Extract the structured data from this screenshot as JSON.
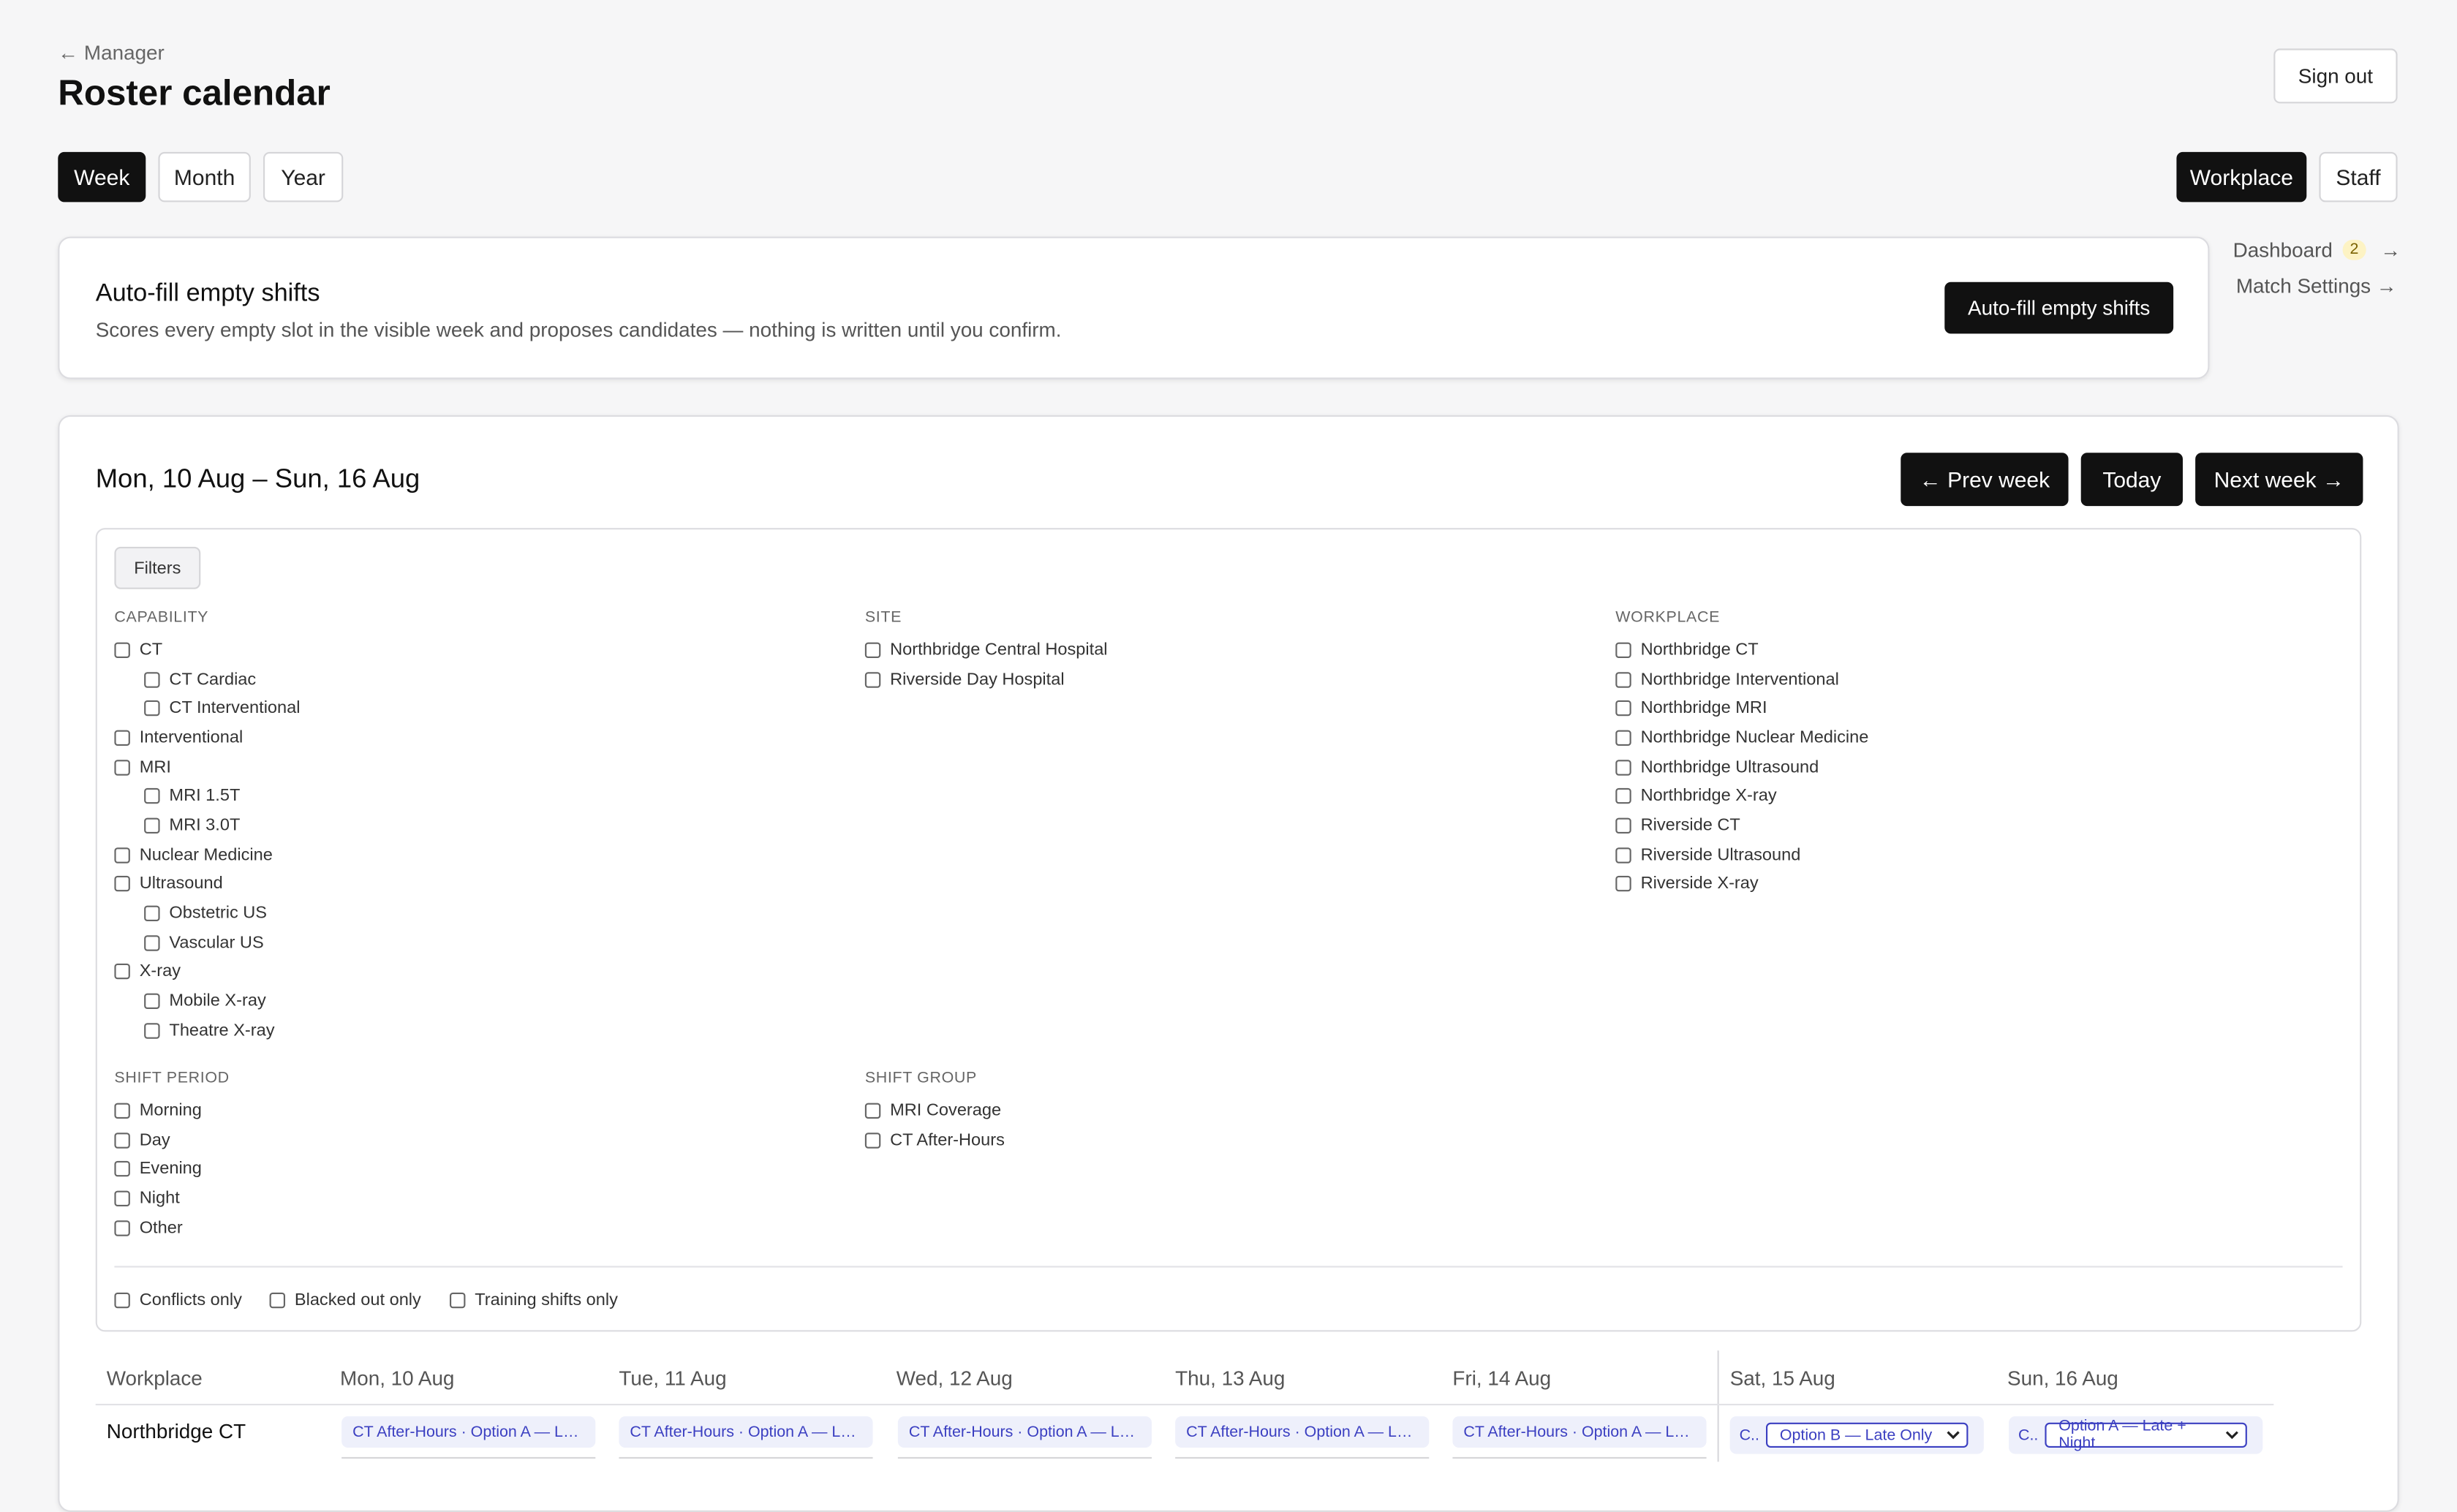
{
  "header": {
    "back_link": "← Manager",
    "title": "Roster calendar",
    "sign_out": "Sign out"
  },
  "view_tabs": [
    {
      "label": "Week",
      "active": true
    },
    {
      "label": "Month",
      "active": false
    },
    {
      "label": "Year",
      "active": false
    }
  ],
  "mode_tabs": [
    {
      "label": "Workplace",
      "active": true
    },
    {
      "label": "Staff",
      "active": false
    }
  ],
  "side_links": {
    "dashboard": "Dashboard",
    "dashboard_badge": "2",
    "dashboard_arrow": "→",
    "match_settings": "Match Settings →"
  },
  "autofill": {
    "title": "Auto-fill empty shifts",
    "description": "Scores every empty slot in the visible week and proposes candidates — nothing is written until you confirm.",
    "button": "Auto-fill empty shifts"
  },
  "calendar": {
    "range": "Mon, 10 Aug – Sun, 16 Aug",
    "prev": "← Prev week",
    "today": "Today",
    "next": "Next week →"
  },
  "filters": {
    "button": "Filters",
    "capability": {
      "title": "CAPABILITY",
      "items": [
        "CT",
        "CT Cardiac",
        "CT Interventional",
        "Interventional",
        "MRI",
        "MRI 1.5T",
        "MRI 3.0T",
        "Nuclear Medicine",
        "Ultrasound",
        "Obstetric US",
        "Vascular US",
        "X-ray",
        "Mobile X-ray",
        "Theatre X-ray"
      ]
    },
    "site": {
      "title": "SITE",
      "items": [
        "Northbridge Central Hospital",
        "Riverside Day Hospital"
      ]
    },
    "workplace": {
      "title": "WORKPLACE",
      "items": [
        "Northbridge CT",
        "Northbridge Interventional",
        "Northbridge MRI",
        "Northbridge Nuclear Medicine",
        "Northbridge Ultrasound",
        "Northbridge X-ray",
        "Riverside CT",
        "Riverside Ultrasound",
        "Riverside X-ray"
      ]
    },
    "shift_period": {
      "title": "SHIFT PERIOD",
      "items": [
        "Morning",
        "Day",
        "Evening",
        "Night",
        "Other"
      ]
    },
    "shift_group": {
      "title": "SHIFT GROUP",
      "items": [
        "MRI Coverage",
        "CT After-Hours"
      ]
    },
    "toggles": [
      "Conflicts only",
      "Blacked out only",
      "Training shifts only"
    ]
  },
  "grid": {
    "columns": [
      "Workplace",
      "Mon, 10 Aug",
      "Tue, 11 Aug",
      "Wed, 12 Aug",
      "Thu, 13 Aug",
      "Fri, 14 Aug",
      "Sat, 15 Aug",
      "Sun, 16 Aug"
    ],
    "rows": [
      {
        "workplace": "Northbridge CT",
        "weekday_cells": [
          "CT After-Hours · Option A — Lat...",
          "CT After-Hours · Option A — Lat...",
          "CT After-Hours · Option A — Lat...",
          "CT After-Hours · Option A — Lat...",
          "CT After-Hours · Option A — Lat..."
        ],
        "weekend_cells": [
          {
            "prefix": "C..",
            "selected": "Option B — Late Only"
          },
          {
            "prefix": "C..",
            "selected": "Option A — Late + Night"
          }
        ]
      }
    ]
  }
}
